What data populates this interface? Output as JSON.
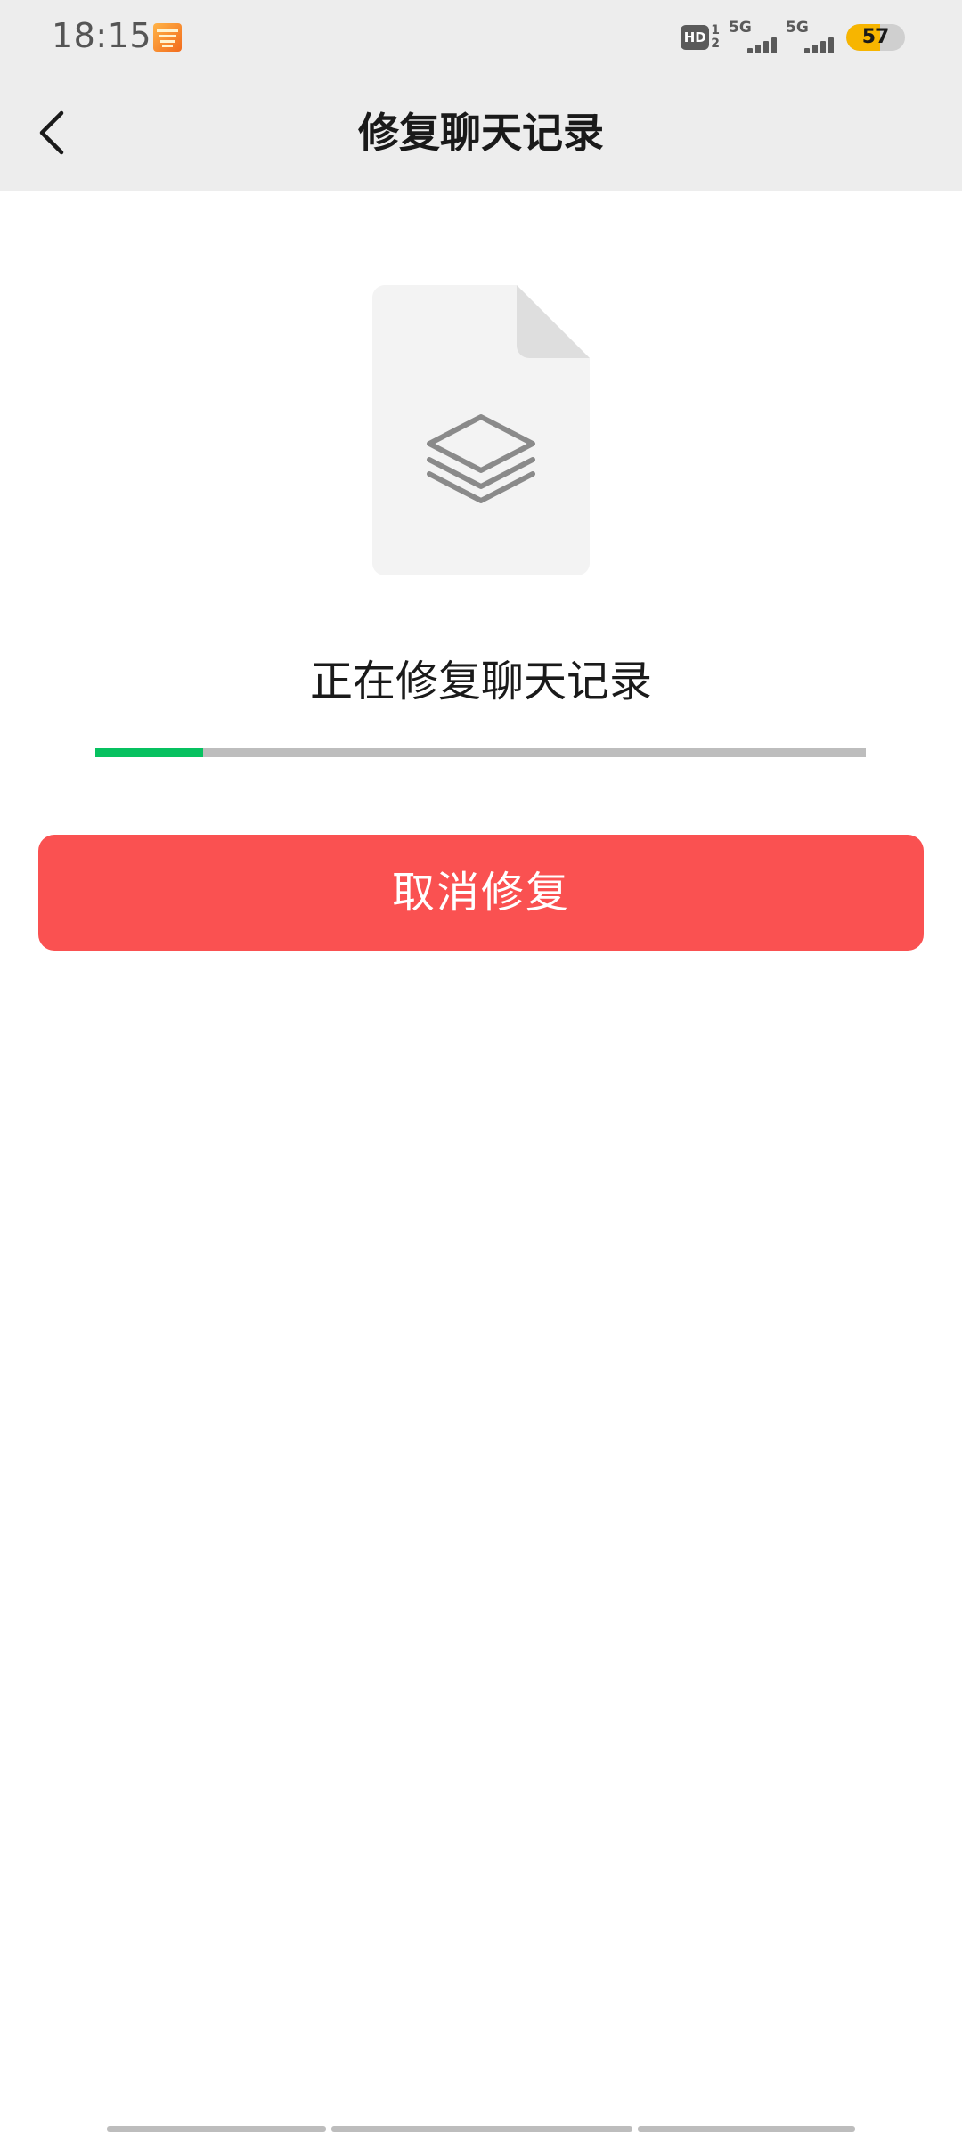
{
  "status_bar": {
    "time": "18:15",
    "hd_label": "HD",
    "sim_slots": [
      "1",
      "2"
    ],
    "signals": [
      {
        "label": "5G",
        "level": 4
      },
      {
        "label": "5G",
        "level": 4
      }
    ],
    "battery": {
      "text": "57",
      "level_percent": 57
    },
    "notification_icon": "app-notification-icon"
  },
  "header": {
    "back_icon": "chevron-left-icon",
    "title": "修复聊天记录"
  },
  "illustration": {
    "icon": "layers-document-icon"
  },
  "repair": {
    "status_text": "正在修复聊天记录",
    "progress_percent": 14,
    "progress_color": "#07c160"
  },
  "actions": {
    "cancel_label": "取消修复",
    "cancel_color": "#fa5151"
  },
  "colors": {
    "header_background": "#ededed",
    "page_background": "#ffffff"
  }
}
